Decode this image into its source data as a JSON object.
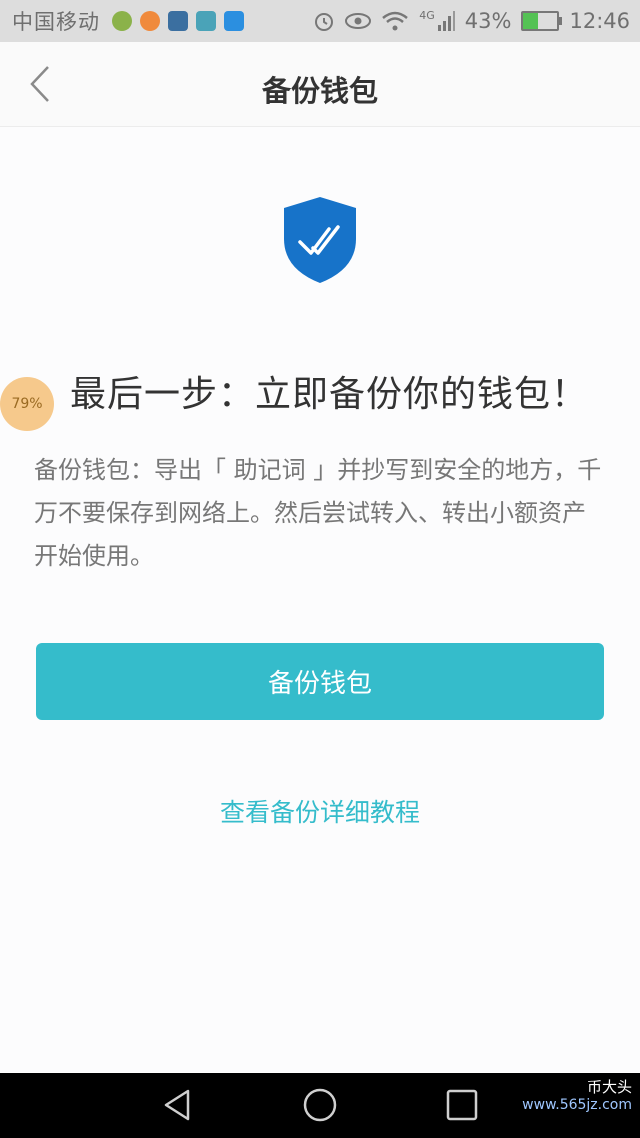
{
  "status_bar": {
    "carrier": "中国移动",
    "network": "4G",
    "battery": "43%",
    "battery_level": 0.43,
    "time": "12:46",
    "icons": [
      "green-app-icon",
      "orange-app-icon",
      "blue-app-icon",
      "usb-icon",
      "alipay-icon",
      "alarm-icon",
      "eye-icon",
      "wifi-icon",
      "signal-icon",
      "battery-icon"
    ]
  },
  "navbar": {
    "back_icon": "chevron-left-icon",
    "title": "备份钱包"
  },
  "main": {
    "shield_icon": "shield-check-icon",
    "shield_color": "#1773c9",
    "progress_badge": "79%",
    "headline": "最后一步：立即备份你的钱包！",
    "description": "备份钱包：导出「 助记词 」并抄写到安全的地方，千万不要保存到网络上。然后尝试转入、转出小额资产开始使用。",
    "primary_button": "备份钱包",
    "primary_color": "#35bccb",
    "tutorial_link": "查看备份详细教程"
  },
  "system_nav": {
    "icons": [
      "back-triangle-icon",
      "home-circle-icon",
      "recents-square-icon"
    ]
  },
  "watermark": {
    "name": "币大头",
    "url": "www.565jz.com"
  }
}
